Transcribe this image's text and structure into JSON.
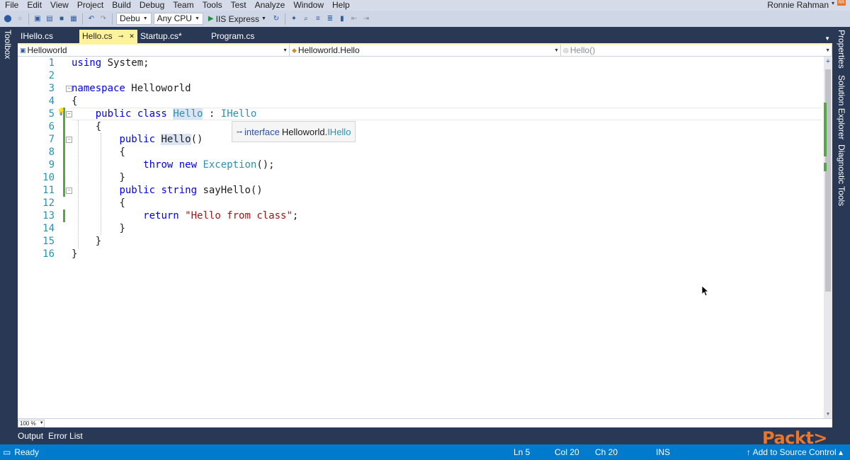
{
  "menu": [
    "File",
    "Edit",
    "View",
    "Project",
    "Build",
    "Debug",
    "Team",
    "Tools",
    "Test",
    "Analyze",
    "Window",
    "Help"
  ],
  "user": {
    "name": "Ronnie Rahman",
    "badge": "RR"
  },
  "toolbar": {
    "config": "Debu",
    "platform": "Any CPU",
    "run_target": "IIS Express"
  },
  "side_tabs": {
    "left": "Toolbox",
    "right": [
      "Properties",
      "Solution Explorer",
      "Diagnostic Tools"
    ]
  },
  "doc_tabs": [
    {
      "label": "IHello.cs",
      "active": false
    },
    {
      "label": "Hello.cs",
      "active": true
    },
    {
      "label": "Startup.cs*",
      "active": false
    },
    {
      "label": "Program.cs",
      "active": false
    }
  ],
  "navbar": {
    "project": "Helloworld",
    "class": "Helloworld.Hello",
    "member": "Hello()"
  },
  "code": {
    "line_numbers": [
      "1",
      "2",
      "3",
      "4",
      "5",
      "6",
      "7",
      "8",
      "9",
      "10",
      "11",
      "12",
      "13",
      "14",
      "15",
      "16"
    ],
    "l1_kw": "using",
    "l1_rest": " System;",
    "l3_kw": "namespace",
    "l3_rest": " Helloworld",
    "l4": "{",
    "l5_kw": "public class",
    "l5_type": "Hello",
    "l5_colon": " : ",
    "l5_iface": "IHello",
    "l6": "{",
    "l7_kw": "public",
    "l7_name": "Hello",
    "l7_rest": "()",
    "l8": "{",
    "l9_kw": "throw new",
    "l9_type": "Exception",
    "l9_rest": "();",
    "l10": "}",
    "l11_kw": "public string",
    "l11_rest": " sayHello()",
    "l12": "{",
    "l13_kw": "return",
    "l13_str": "\"Hello from class\"",
    "l13_rest": ";",
    "l14": "}",
    "l15": "}",
    "l16": "}"
  },
  "tooltip": {
    "keyword": "interface",
    "namespace": "Helloworld.",
    "type": "IHello"
  },
  "zoom": "100 %",
  "bottom_tabs": [
    "Output",
    "Error List"
  ],
  "status": {
    "ready": "Ready",
    "ln": "Ln 5",
    "col": "Col 20",
    "ch": "Ch 20",
    "ins": "INS",
    "source_control": "↑ Add to Source Control ▴"
  },
  "logo": "Packt>",
  "colors": {
    "status_bar": "#007acc",
    "active_tab": "#fff29d",
    "frame": "#293955",
    "keyword": "#0000ff",
    "type": "#2b91af",
    "string": "#a31515"
  }
}
